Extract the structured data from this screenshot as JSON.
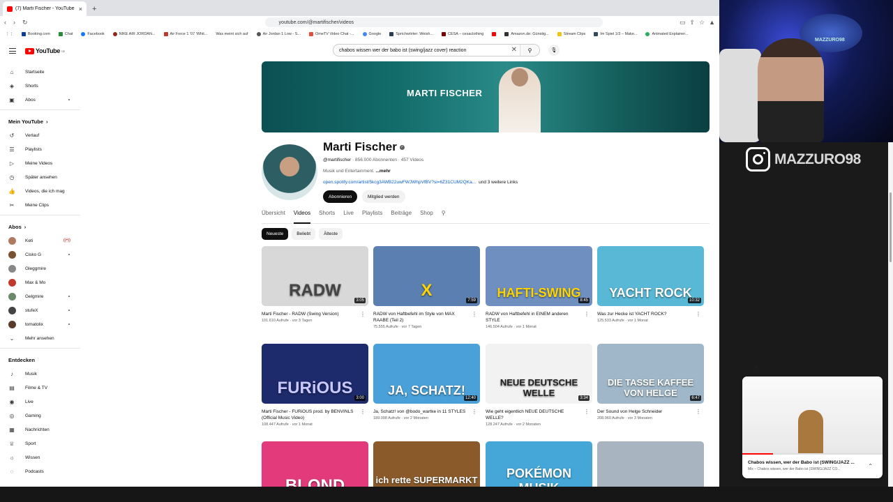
{
  "browser": {
    "tab_title": "(7) Marti Fischer - YouTube",
    "tab_close": "×",
    "new_tab": "+",
    "url": "youtube.com/@martifischer/videos",
    "bookmarks": [
      "Booking.com",
      "Chat",
      "Facebook",
      "NIKE AIR JORDAN...",
      "Air Force 1 '07 'Whit...",
      "Was meint sich auf",
      "Air Jordan 1 Low - S...",
      "OmeTV Video Chat -...",
      "Google",
      "Sprichwörter: Weish...",
      "CESA – cesaclothing",
      "",
      "Amazon.de: Günstig...",
      "Stream Clips",
      "Im Spiel 1/3 – Make...",
      "Animated Explainer..."
    ]
  },
  "youtube": {
    "logo": "YouTube",
    "logo_region": "DE",
    "search_query": "chabos wissen wer der babo ist (swing/jazz cover) reaction",
    "sidebar": {
      "main": [
        "Startseite",
        "Shorts",
        "Abos"
      ],
      "you_header": "Mein YouTube",
      "you": [
        "Verlauf",
        "Playlists",
        "Meine Videos",
        "Später ansehen",
        "Videos, die ich mag",
        "Meine Clips"
      ],
      "subs_header": "Abos",
      "subs": [
        "Keti",
        "Cisko G",
        "Gleggmire",
        "Max & Mo",
        "Gelgmire",
        "stufeX",
        "tomatolix",
        "Mehr ansehen"
      ],
      "explore_header": "Entdecken",
      "explore": [
        "Musik",
        "Filme & TV",
        "Live",
        "Gaming",
        "Nachrichten",
        "Sport",
        "Wissen",
        "Podcasts"
      ]
    },
    "channel": {
      "banner_text": "MARTI FISCHER",
      "name": "Marti Fischer",
      "handle": "@martifischer",
      "subs": "856.000 Abonnenten",
      "videos": "457 Videos",
      "desc": "Musik und Entertainment.",
      "more": "...mehr",
      "link": "open.spotify.com/artist/5kcg3AWB22uwFWJWhpVfBV?si=6Z31CUM2QKa...",
      "link_more": "und 3 weitere Links",
      "subscribe": "Abonnieren",
      "join": "Mitglied werden"
    },
    "tabs": [
      "Übersicht",
      "Videos",
      "Shorts",
      "Live",
      "Playlists",
      "Beiträge",
      "Shop"
    ],
    "chips": [
      "Neueste",
      "Beliebt",
      "Älteste"
    ],
    "videos": [
      {
        "title": "Marti Fischer - RADW (Swing Version)",
        "views": "101.610 Aufrufe",
        "age": "vor 3 Tagen",
        "dur": "3:05",
        "thumb_text": "RADW",
        "bg": "#d8d8d8",
        "fg": "#444"
      },
      {
        "title": "RADW von Haftbefehl im Style von MAX RAABE (Teil 2)",
        "views": "75.555 Aufrufe",
        "age": "vor 7 Tagen",
        "dur": "7:59",
        "thumb_text": "X",
        "bg": "#5a7fb0",
        "fg": "#ffd400"
      },
      {
        "title": "RADW von Haftbefehl in EINEM anderen STYLE",
        "views": "146.504 Aufrufe",
        "age": "vor 1 Monat",
        "dur": "8:45",
        "thumb_text": "HAFTI-SWING",
        "bg": "#6e8fbf",
        "fg": "#ffd400"
      },
      {
        "title": "Was zur Hecke ist YACHT ROCK?",
        "views": "125.533 Aufrufe",
        "age": "vor 1 Monat",
        "dur": "10:32",
        "thumb_text": "YACHT ROCK",
        "bg": "#58b8d6",
        "fg": "#ffffff"
      },
      {
        "title": "Marti Fischer - FURiOUS prod. by BENVINLS (Official Music Video)",
        "views": "108.447 Aufrufe",
        "age": "vor 1 Monat",
        "dur": "3:00",
        "thumb_text": "FURiOUS",
        "bg": "#1d2a6b",
        "fg": "#c8c8ff"
      },
      {
        "title": "Ja, Schatz! von @bodo_wartke in 11 STYLES",
        "views": "189.098 Aufrufe",
        "age": "vor 2 Monaten",
        "dur": "12:40",
        "thumb_text": "JA, SCHATZ!",
        "bg": "#4aa0d8",
        "fg": "#ffffff"
      },
      {
        "title": "Wie geht eigentlich NEUE DEUTSCHE WELLE?",
        "views": "128.247 Aufrufe",
        "age": "vor 2 Monaten",
        "dur": "3:34",
        "thumb_text": "NEUE DEUTSCHE WELLE",
        "bg": "#f2f2f2",
        "fg": "#222"
      },
      {
        "title": "Der Sound von Helge Schneider",
        "views": "208.060 Aufrufe",
        "age": "vor 3 Monaten",
        "dur": "6:47",
        "thumb_text": "DIE TASSE KAFFEE VON HELGE",
        "bg": "#9fb7c8",
        "fg": "#ffffff"
      },
      {
        "title": "",
        "views": "",
        "age": "",
        "dur": "",
        "thumb_text": "BLOND",
        "bg": "#e23a7a",
        "fg": "#ffffff"
      },
      {
        "title": "",
        "views": "",
        "age": "",
        "dur": "",
        "thumb_text": "ich rette SUPERMARKT MUSIK",
        "bg": "#8a5a2a",
        "fg": "#ffffff"
      },
      {
        "title": "",
        "views": "",
        "age": "",
        "dur": "",
        "thumb_text": "POKÉMON MUSIK",
        "bg": "#45a7d8",
        "fg": "#ffffff"
      },
      {
        "title": "",
        "views": "",
        "age": "",
        "dur": "",
        "thumb_text": "",
        "bg": "#a8b4c0",
        "fg": "#ffffff"
      }
    ],
    "miniplayer": {
      "title": "Chabos wissen, wer der Babo ist (SWING/JAZZ ...",
      "sub": "Mix – Chabos wissen, wer der Babo ist (SWING/JAZZ CO...",
      "progress": 0.22
    }
  },
  "overlay": {
    "instagram": "MAZZURO98",
    "cam_logo": "MAZZURO98"
  }
}
